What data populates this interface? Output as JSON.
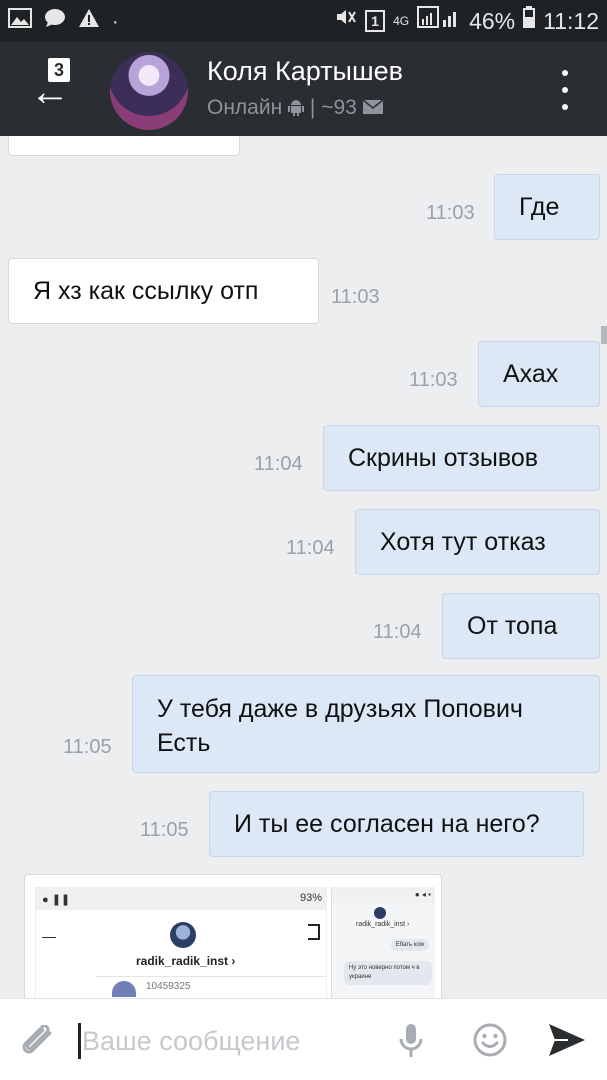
{
  "status_bar": {
    "sim_label": "1",
    "network": "4G",
    "battery": "46%",
    "time": "11:12"
  },
  "header": {
    "unread_count": "3",
    "contact_name": "Коля Картышев",
    "status_text": "Онлайн",
    "status_extra": "~93",
    "icons": [
      "back-arrow-icon",
      "android-icon",
      "envelope-icon",
      "more-vertical-icon"
    ]
  },
  "messages": [
    {
      "direction": "out",
      "text": "Где",
      "time": "11:03"
    },
    {
      "direction": "in",
      "text": "Я хз как ссылку отп",
      "time": "11:03"
    },
    {
      "direction": "out",
      "text": "Ахах",
      "time": "11:03"
    },
    {
      "direction": "out",
      "text": "Скрины отзывов",
      "time": "11:04"
    },
    {
      "direction": "out",
      "text": "Хотя тут отказ",
      "time": "11:04"
    },
    {
      "direction": "out",
      "text": "От топа",
      "time": "11:04"
    },
    {
      "direction": "out",
      "text": "У тебя даже в друзьях Попович\nЕсть",
      "time": "11:05"
    },
    {
      "direction": "out",
      "text": "И ты ее согласен на него?",
      "time": "11:05"
    }
  ],
  "attachment": {
    "screenshot_1": {
      "status": "93%",
      "username": "radik_radik_inst ›",
      "number": "10459325"
    },
    "screenshot_2": {
      "username": "radik_radik_inst ›",
      "bubble_1": "Ебать ком",
      "bubble_2": "Ну это новерно потом ч в украине"
    }
  },
  "input": {
    "placeholder": "Ваше сообщение",
    "icons": [
      "paperclip-icon",
      "microphone-icon",
      "smile-icon",
      "send-icon"
    ]
  },
  "colors": {
    "header_bg": "#2a2d31",
    "chat_bg": "#edeef0",
    "outgoing_bubble": "#dce8f6",
    "incoming_bubble": "#ffffff",
    "time_text": "#9aa1a9"
  }
}
